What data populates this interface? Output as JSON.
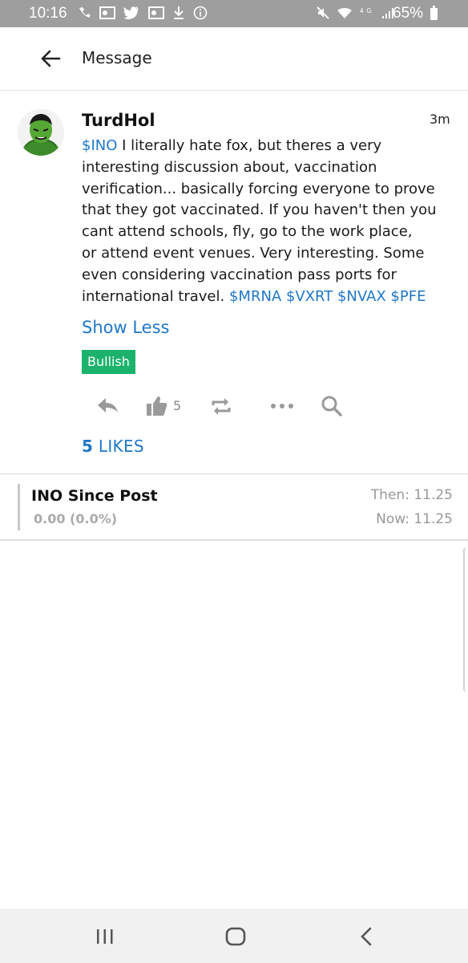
{
  "status_bar": {
    "time": "10:16",
    "battery": "65%",
    "left_icons": [
      "wifi-calling-icon",
      "outlook-icon",
      "twitter-icon",
      "outlook-icon",
      "download-icon",
      "info-icon"
    ],
    "right_icons": [
      "mute-icon",
      "wifi-icon",
      "4g-icon",
      "signal-icon",
      "battery-icon"
    ]
  },
  "header": {
    "title": "Message"
  },
  "post": {
    "username": "TurdHol",
    "timestamp": "3m",
    "lines": [
      {
        "tag": "$INO",
        "text": " I literally hate fox, but theres a very"
      },
      {
        "text": "interesting discussion about, vaccination"
      },
      {
        "text": "verification... basically forcing everyone to prove"
      },
      {
        "text": "that they got vaccinated. If you haven't then you"
      },
      {
        "text": "cant attend schools, fly, go to the work place,"
      },
      {
        "text": "or attend event venues. Very interesting. Some"
      },
      {
        "text": "even considering vaccination pass ports for"
      },
      {
        "text": "international travel. ",
        "tail_tags": "$MRNA $VXRT $NVAX $PFE"
      }
    ],
    "show_less": "Show Less",
    "sentiment": "Bullish",
    "like_count": "5",
    "likes_summary_count": "5",
    "likes_summary_label": "LIKES",
    "colors": {
      "link": "#1f77c9",
      "bullish": "#1bb36b"
    }
  },
  "price_panel": {
    "title": "INO Since Post",
    "change": "0.00 (0.0%)",
    "then": "Then: 11.25",
    "now": "Now: 11.25"
  }
}
